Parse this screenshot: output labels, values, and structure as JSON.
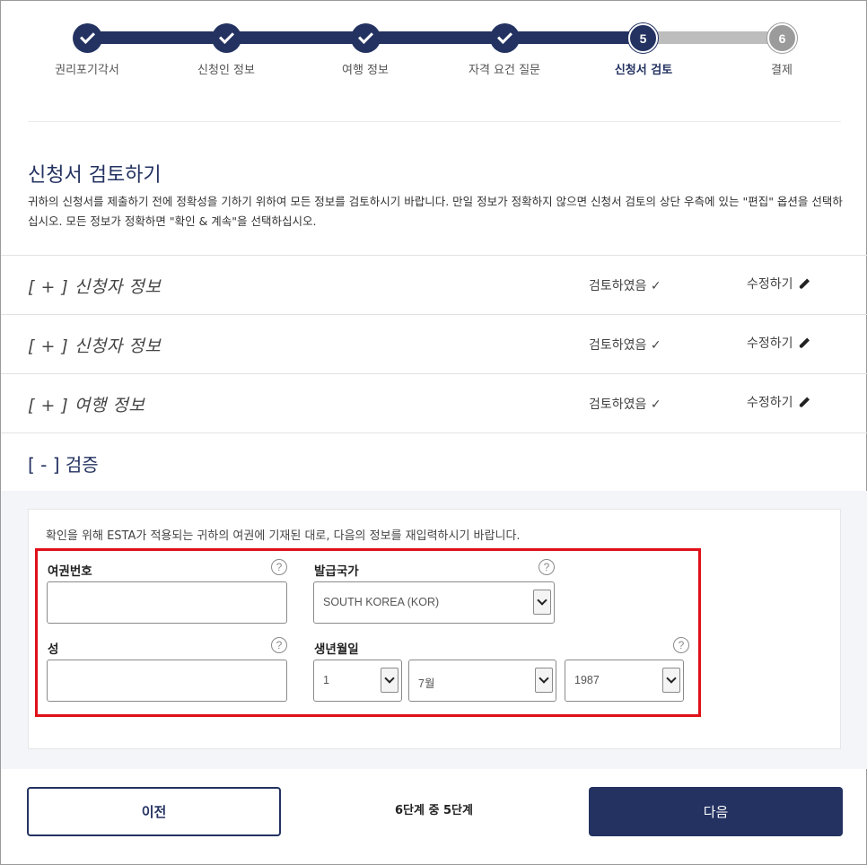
{
  "stepper": {
    "steps": [
      {
        "label": "권리포기각서",
        "state": "done"
      },
      {
        "label": "신청인 정보",
        "state": "done"
      },
      {
        "label": "여행 정보",
        "state": "done"
      },
      {
        "label": "자격 요건 질문",
        "state": "done"
      },
      {
        "label": "신청서 검토",
        "state": "current",
        "number": "5"
      },
      {
        "label": "결제",
        "state": "todo",
        "number": "6"
      }
    ]
  },
  "review": {
    "title": "신청서 검토하기",
    "intro": "귀하의 신청서를 제출하기 전에 정확성을 기하기 위하여 모든 정보를 검토하시기 바랍니다. 만일 정보가 정확하지 않으면 신청서 검토의 상단 우측에 있는 \"편집\" 옵션을 선택하십시오. 모든 정보가 정확하면 \"확인 & 계속\"을 선택하십시오."
  },
  "sections": [
    {
      "title": "[ + ] 신청자 정보",
      "status": "검토하였음 ✓",
      "edit": "수정하기"
    },
    {
      "title": "[ + ] 신청자 정보",
      "status": "검토하였음 ✓",
      "edit": "수정하기"
    },
    {
      "title": "[ + ] 여행 정보",
      "status": "검토하였음 ✓",
      "edit": "수정하기"
    }
  ],
  "verify": {
    "title": "[ - ] 검증",
    "instruction": "확인을 위해 ESTA가 적용되는 귀하의 여권에 기재된 대로, 다음의 정보를 재입력하시기 바랍니다.",
    "passport_label": "여권번호",
    "passport_value": "",
    "country_label": "발급국가",
    "country_value": "SOUTH KOREA (KOR)",
    "surname_label": "성",
    "surname_value": "",
    "dob_label": "생년월일",
    "dob_day": "1",
    "dob_month": "7월",
    "dob_year": "1987",
    "help_glyph": "?"
  },
  "footer": {
    "prev_label": "이전",
    "step_count": "6단계 중 5단계",
    "next_label": "다음"
  },
  "colors": {
    "navy": "#233261",
    "highlight_red": "#e01019",
    "todo_gray": "#9b9b9b"
  }
}
